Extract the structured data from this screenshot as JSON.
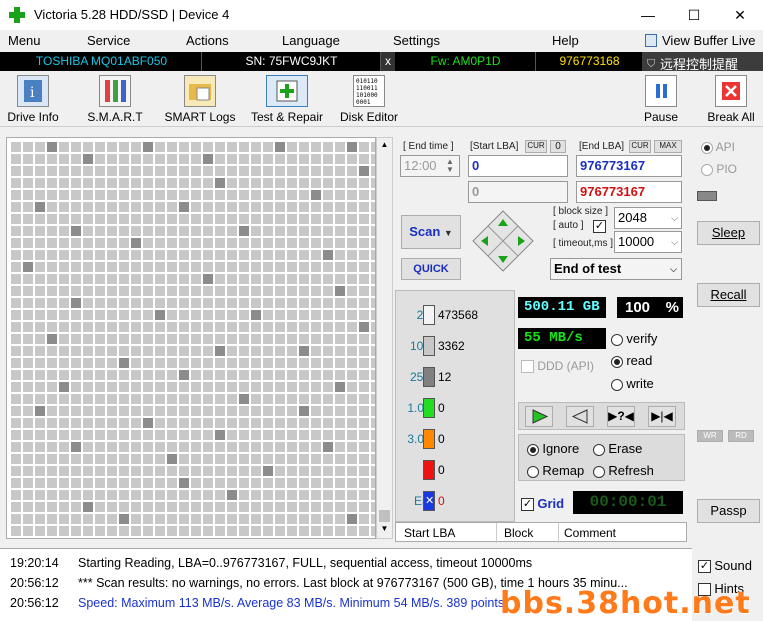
{
  "window": {
    "title": "Victoria 5.28 HDD/SSD | Device 4"
  },
  "menu": [
    "Menu",
    "Service",
    "Actions",
    "Language",
    "Settings",
    "Help"
  ],
  "view_buffer": "View Buffer Live",
  "device": {
    "model": "TOSHIBA MQ01ABF050",
    "serial": "SN: 75FWC9JKT",
    "close": "x",
    "firmware": "Fw: AM0P1D",
    "lba": "976773168"
  },
  "remote_tooltip": "远程控制提醒",
  "toolbar": {
    "drive_info": "Drive Info",
    "smart": "S.M.A.R.T",
    "smart_logs": "SMART Logs",
    "test_repair": "Test & Repair",
    "disk_editor": "Disk Editor",
    "pause": "Pause",
    "break_all": "Break All",
    "disk_editor_bits": "010110\n110011\n101000\n0001"
  },
  "controls": {
    "end_time_label": "[ End time ]",
    "end_time": "12:00",
    "start_lba_label": "[Start LBA]",
    "cur": "CUR",
    "cur_val": "0",
    "start_lba": "0",
    "start_lba2": "0",
    "end_lba_label": "[End LBA]",
    "max": "MAX",
    "end_lba": "976773167",
    "end_lba2": "976773167",
    "scan": "Scan",
    "quick": "QUICK",
    "block_size_label": "[ block size ]",
    "auto_label": "[ auto ]",
    "block_size": "2048",
    "timeout_label": "[ timeout,ms ]",
    "timeout": "10000",
    "test_mode": "End of test"
  },
  "stats": [
    {
      "label": "25",
      "value": "473568",
      "color": "#f4f4f4"
    },
    {
      "label": "100",
      "value": "3362",
      "color": "#c8c8c8"
    },
    {
      "label": "250",
      "value": "12",
      "color": "#808080"
    },
    {
      "label": "1.0s",
      "value": "0",
      "color": "#22dd22"
    },
    {
      "label": "3.0s",
      "value": "0",
      "color": "#ff8800"
    },
    {
      "label": ">",
      "value": "0",
      "color": "#ee1111"
    },
    {
      "label": "Err",
      "value": "0",
      "color": "#1a3ae0"
    }
  ],
  "readout": {
    "size": "500.11 GB",
    "percent": "100",
    "pct_sign": "%",
    "speed": "55 MB/s",
    "verify": "verify",
    "read": "read",
    "write": "write",
    "ddd": "DDD (API)"
  },
  "actions": {
    "ignore": "Ignore",
    "erase": "Erase",
    "remap": "Remap",
    "refresh": "Refresh",
    "grid": "Grid",
    "timer": "00:00:01"
  },
  "side": {
    "api": "API",
    "pio": "PIO",
    "sleep": "Sleep",
    "recall": "Recall",
    "wr": "WR",
    "rd": "RD",
    "passp": "Passp",
    "sound": "Sound",
    "hints": "Hints"
  },
  "table": {
    "col1": "Start LBA",
    "col2": "Block",
    "col3": "Comment"
  },
  "log": [
    {
      "time": "19:20:14",
      "msg": "Starting Reading, LBA=0..976773167, FULL, sequential access, timeout 10000ms",
      "color": "#000000"
    },
    {
      "time": "20:56:12",
      "msg": "*** Scan results: no warnings, no errors. Last block at 976773167 (500 GB), time 1 hours 35 minu...",
      "color": "#000000"
    },
    {
      "time": "20:56:12",
      "msg": "Speed: Maximum 113 MB/s. Average 83 MB/s. Minimum 54 MB/s. 389 points.",
      "color": "#1a33cc"
    }
  ],
  "watermark": "bbs.38hot.net"
}
